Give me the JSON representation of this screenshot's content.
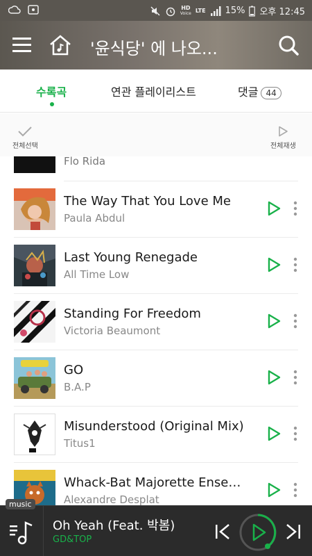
{
  "status_bar": {
    "battery": "15%",
    "time": "오후 12:45",
    "network_hd": "HD",
    "network_voice": "Voice",
    "network_lte": "LTE"
  },
  "header": {
    "title": "'윤식당' 에 나오..."
  },
  "tabs": [
    {
      "label": "수록곡"
    },
    {
      "label": "연관 플레이리스트"
    },
    {
      "label": "댓글",
      "count": "44"
    }
  ],
  "actions": {
    "select_all": "전체선택",
    "play_all": "전체재생"
  },
  "partial_track": {
    "artist": "Flo Rida"
  },
  "tracks": [
    {
      "title": "The Way That You Love Me",
      "artist": "Paula Abdul"
    },
    {
      "title": "Last Young Renegade",
      "artist": "All Time Low"
    },
    {
      "title": "Standing For Freedom",
      "artist": "Victoria Beaumont"
    },
    {
      "title": "GO",
      "artist": "B.A.P"
    },
    {
      "title": "Misunderstood (Original Mix)",
      "artist": "Titus1"
    },
    {
      "title": "Whack-Bat Majorette Ensem...",
      "artist": "Alexandre Desplat"
    }
  ],
  "player": {
    "label": "music",
    "title": "Oh Yeah (Feat. 박봄)",
    "artist": "GD&TOP"
  },
  "colors": {
    "accent": "#19b14a",
    "header_bg": "#6f6a62",
    "player_bg": "#2b2b2b"
  }
}
